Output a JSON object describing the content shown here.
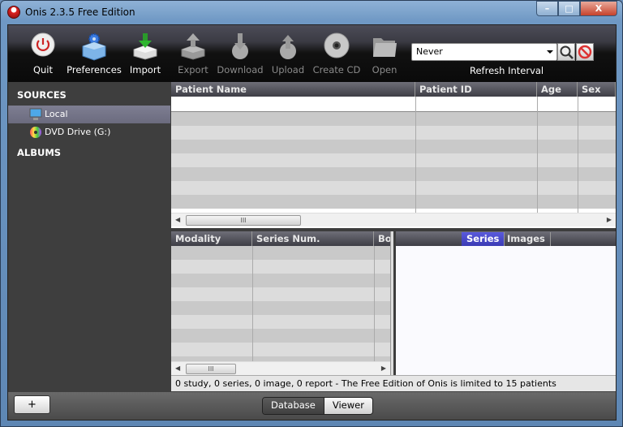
{
  "window": {
    "title": "Onis 2.3.5 Free Edition",
    "minimize": "–",
    "maximize": "□",
    "close": "X"
  },
  "toolbar": {
    "buttons": [
      {
        "label": "Quit",
        "icon": "power-icon",
        "enabled": true
      },
      {
        "label": "Preferences",
        "icon": "preferences-gear-box-icon",
        "enabled": true
      },
      {
        "label": "Import",
        "icon": "import-arrow-down-icon",
        "enabled": true
      },
      {
        "label": "Export",
        "icon": "export-arrow-up-icon",
        "enabled": false
      },
      {
        "label": "Download",
        "icon": "download-icon",
        "enabled": false
      },
      {
        "label": "Upload",
        "icon": "upload-icon",
        "enabled": false
      },
      {
        "label": "Create CD",
        "icon": "cd-icon",
        "enabled": false
      },
      {
        "label": "Open",
        "icon": "folder-icon",
        "enabled": false
      }
    ],
    "refresh": {
      "value": "Never",
      "label": "Refresh Interval"
    }
  },
  "sidebar": {
    "sources_header": "SOURCES",
    "sources": [
      {
        "label": "Local",
        "icon": "monitor-icon",
        "selected": true
      },
      {
        "label": "DVD Drive (G:)",
        "icon": "dvd-icon",
        "selected": false
      }
    ],
    "albums_header": "ALBUMS"
  },
  "patients_table": {
    "columns": [
      "Patient Name",
      "Patient ID",
      "Age",
      "Sex"
    ],
    "rows": []
  },
  "series_table": {
    "columns": [
      "Modality",
      "Series Num.",
      "Bo"
    ],
    "rows": []
  },
  "right_panel": {
    "tabs": [
      {
        "label": "Series",
        "active": true
      },
      {
        "label": "Images",
        "active": false
      }
    ]
  },
  "status": "0 study, 0 series, 0 image, 0 report - The Free Edition of Onis is limited to 15 patients",
  "bottom": {
    "add_label": "+",
    "views": [
      {
        "label": "Database",
        "active": true
      },
      {
        "label": "Viewer",
        "active": false
      }
    ]
  }
}
